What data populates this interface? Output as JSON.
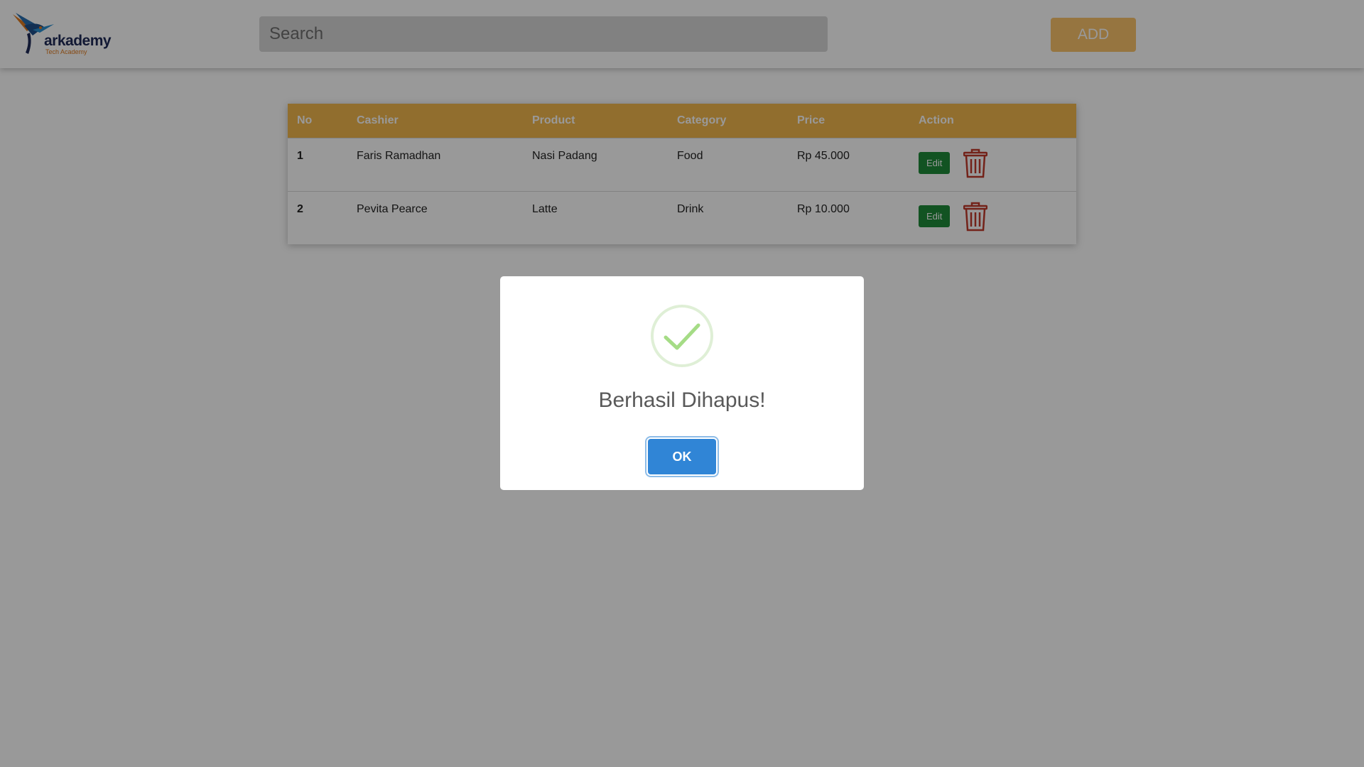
{
  "header": {
    "logo_word": "arkademy",
    "logo_tagline": "Tech Academy",
    "search_placeholder": "Search",
    "add_label": "ADD"
  },
  "table": {
    "columns": [
      "No",
      "Cashier",
      "Product",
      "Category",
      "Price",
      "Action"
    ],
    "rows": [
      {
        "no": "1",
        "cashier": "Faris Ramadhan",
        "product": "Nasi Padang",
        "category": "Food",
        "price": "Rp 45.000",
        "edit_label": "Edit"
      },
      {
        "no": "2",
        "cashier": "Pevita Pearce",
        "product": "Latte",
        "category": "Drink",
        "price": "Rp 10.000",
        "edit_label": "Edit"
      }
    ]
  },
  "modal": {
    "icon": "success-check-icon",
    "title": "Berhasil Dihapus!",
    "ok_label": "OK"
  },
  "colors": {
    "accent": "#f2b74e",
    "add_button": "#fbc36b",
    "edit_button": "#1f8b3a",
    "delete_icon": "#c0392b",
    "ok_button": "#3085d6",
    "success": "#a5dc86"
  },
  "icons": {
    "logo": "hummingbird-logo-icon",
    "delete": "trash-icon"
  }
}
